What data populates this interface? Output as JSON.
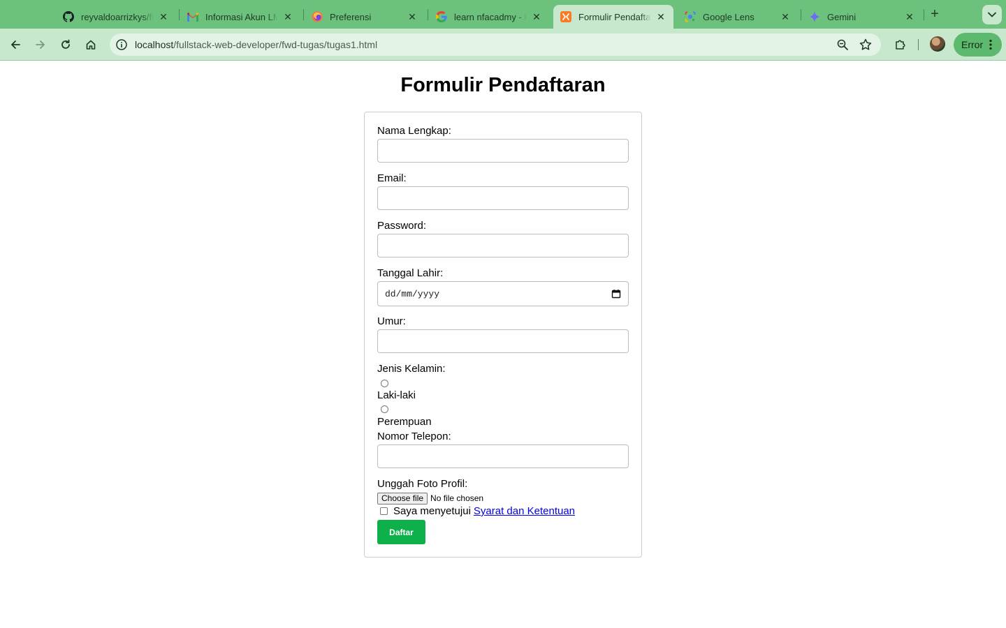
{
  "browser": {
    "tabs": [
      {
        "title": "reyvaldoarrizkys/fu",
        "icon": "github-icon",
        "active": false
      },
      {
        "title": "Informasi Akun LMS",
        "icon": "gmail-icon",
        "active": false
      },
      {
        "title": "Preferensi",
        "icon": "firefox-icon",
        "active": false
      },
      {
        "title": "learn nfacadmy - P",
        "icon": "google-icon",
        "active": false
      },
      {
        "title": "Formulir Pendaftaran",
        "icon": "xampp-icon",
        "active": true
      },
      {
        "title": "Google Lens",
        "icon": "google-lens-icon",
        "active": false
      },
      {
        "title": "Gemini",
        "icon": "gemini-icon",
        "active": false
      }
    ],
    "new_tab_label": "+",
    "address": {
      "host": "localhost",
      "path": "/fullstack-web-developer/fwd-tugas/tugas1.html"
    },
    "profile_status": "Error",
    "colors": {
      "tabstrip": "#6cc27c",
      "toolbar": "#c7e8cc",
      "omnibox": "#e3f3e6"
    }
  },
  "page": {
    "title": "Formulir Pendaftaran",
    "form": {
      "name_label": "Nama Lengkap:",
      "name_value": "",
      "email_label": "Email:",
      "email_value": "",
      "password_label": "Password:",
      "password_value": "",
      "birthdate_label": "Tanggal Lahir:",
      "birthdate_placeholder": "dd/mm/yyyy",
      "age_label": "Umur:",
      "age_value": "",
      "gender_label": "Jenis Kelamin:",
      "gender_options": [
        "Laki-laki",
        "Perempuan"
      ],
      "phone_label": "Nomor Telepon:",
      "phone_value": "",
      "photo_label": "Unggah Foto Profil:",
      "file_button_label": "Choose file",
      "file_status": "No file chosen",
      "agree_text": "Saya menyetujui",
      "agree_link": "Syarat dan Ketentuan",
      "submit_label": "Daftar"
    },
    "colors": {
      "submit_button": "#0db04b",
      "link": "#0000ee"
    }
  }
}
